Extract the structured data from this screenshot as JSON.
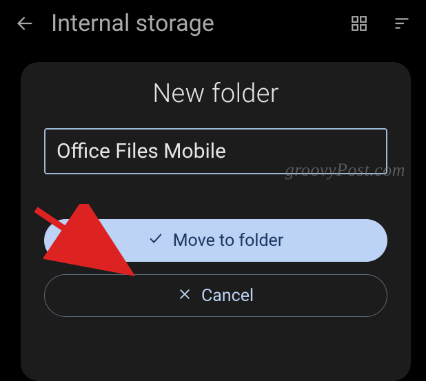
{
  "appbar": {
    "title": "Internal storage"
  },
  "dialog": {
    "title": "New folder",
    "folder_name_value": "Office Files Mobile",
    "primary_label": "Move to folder",
    "secondary_label": "Cancel"
  },
  "watermark": "groovyPost.com"
}
